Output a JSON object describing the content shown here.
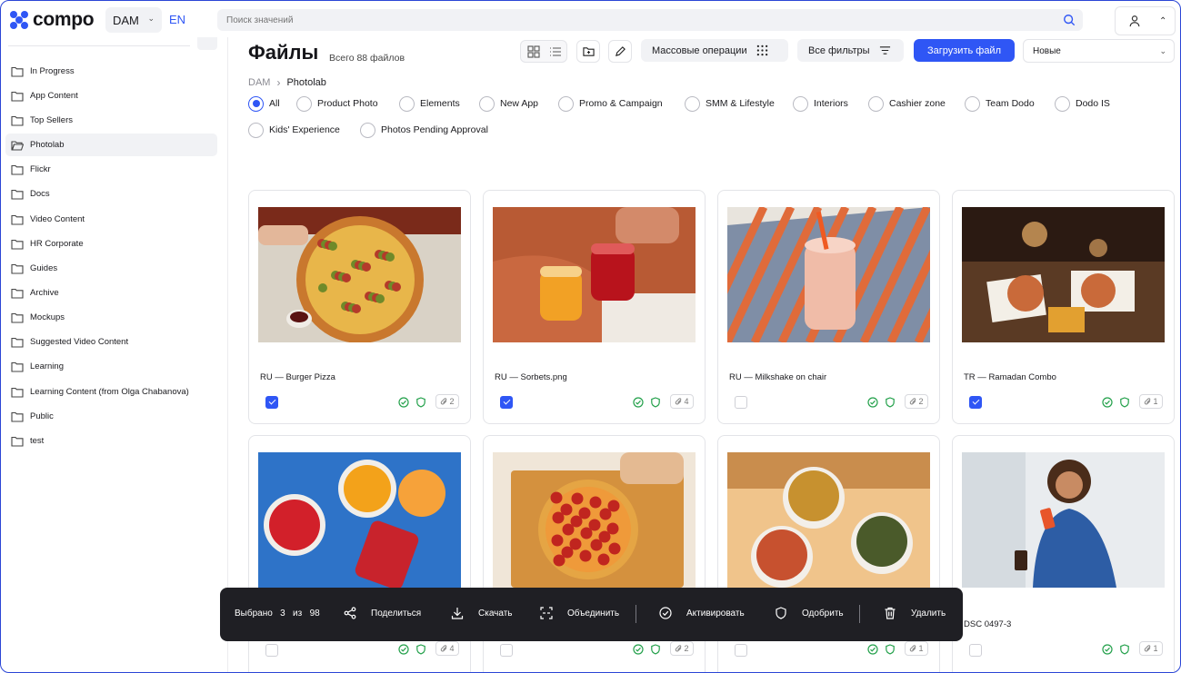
{
  "app": {
    "logo_text": "compo",
    "brand_color": "#2f56f5"
  },
  "header": {
    "workspace": "DAM",
    "language": "EN",
    "search_placeholder": "Поиск значений"
  },
  "sidebar": {
    "items": [
      {
        "label": "In Progress"
      },
      {
        "label": "App Content"
      },
      {
        "label": "Top Sellers"
      },
      {
        "label": "Photolab",
        "active": true
      },
      {
        "label": "Flickr"
      },
      {
        "label": "Docs"
      },
      {
        "label": "Video Content"
      },
      {
        "label": "HR Corporate"
      },
      {
        "label": "Guides"
      },
      {
        "label": "Archive"
      },
      {
        "label": "Mockups"
      },
      {
        "label": "Suggested Video Content"
      },
      {
        "label": "Learning"
      },
      {
        "label": "Learning Content (from Olga Chabanova)"
      },
      {
        "label": "Public"
      },
      {
        "label": "test"
      }
    ]
  },
  "main": {
    "title": "Файлы",
    "count_text": "Всего 88 файлов",
    "bulk_label": "Массовые операции",
    "filters_label": "Все фильтры",
    "upload_label": "Загрузить файл",
    "sort_value": "Новые",
    "breadcrumb": {
      "root": "DAM",
      "current": "Photolab"
    },
    "filters": [
      {
        "label": "All",
        "selected": true
      },
      {
        "label": "Product Photo"
      },
      {
        "label": "Elements"
      },
      {
        "label": "New App"
      },
      {
        "label": "Promo & Campaign"
      },
      {
        "label": "SMM & Lifestyle"
      },
      {
        "label": "Interiors"
      },
      {
        "label": "Cashier zone"
      },
      {
        "label": "Team Dodo"
      },
      {
        "label": "Dodo IS"
      },
      {
        "label": "Kids' Experience"
      },
      {
        "label": "Photos Pending Approval"
      }
    ],
    "cards": [
      {
        "name": "RU — Burger Pizza",
        "checked": true,
        "attachments": "2"
      },
      {
        "name": "RU — Sorbets.png",
        "checked": true,
        "attachments": "4"
      },
      {
        "name": "RU — Milkshake on chair",
        "checked": false,
        "attachments": "2"
      },
      {
        "name": "TR — Ramadan Combo",
        "checked": true,
        "attachments": "1"
      },
      {
        "name": "",
        "checked": false,
        "attachments": "4"
      },
      {
        "name": "",
        "checked": false,
        "attachments": "2"
      },
      {
        "name": "",
        "checked": false,
        "attachments": "1"
      },
      {
        "name": "DSC 0497-3",
        "checked": false,
        "attachments": "1"
      }
    ]
  },
  "actionbar": {
    "selected_prefix": "Выбрано",
    "selected_count": "3",
    "of_label": "из",
    "total": "98",
    "share": "Поделиться",
    "download": "Скачать",
    "merge": "Объединить",
    "activate": "Активировать",
    "approve": "Одобрить",
    "delete": "Удалить"
  }
}
